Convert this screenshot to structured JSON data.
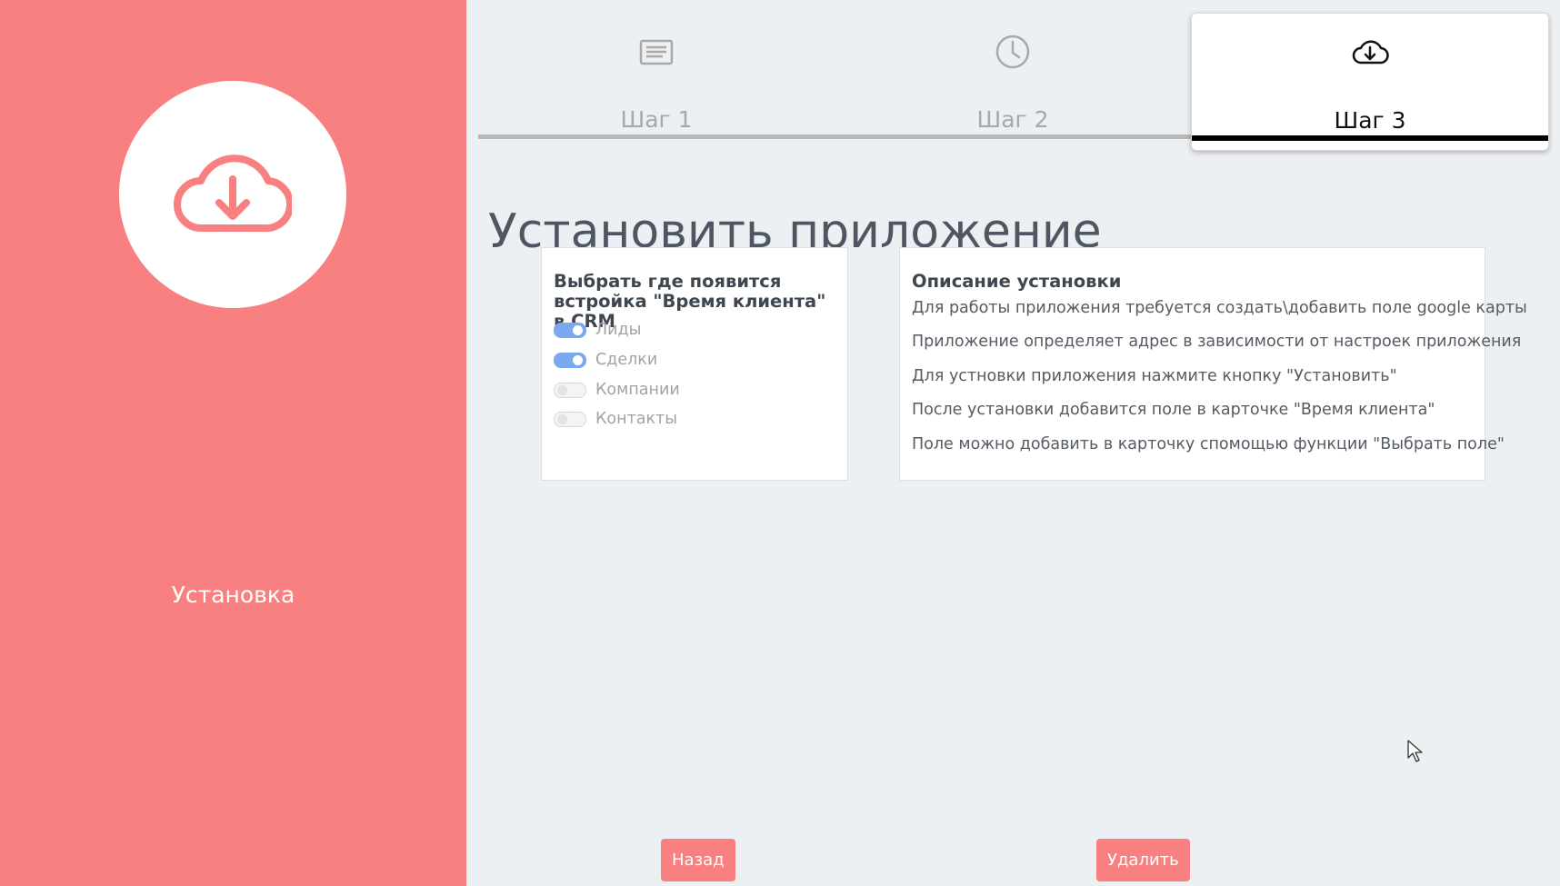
{
  "sidebar": {
    "icon": "cloud-download-icon",
    "caption": "Установка"
  },
  "tabs": [
    {
      "label": "Шаг 1",
      "icon": "document-lines-icon",
      "active": false
    },
    {
      "label": "Шаг 2",
      "icon": "clock-icon",
      "active": false
    },
    {
      "label": "Шаг 3",
      "icon": "cloud-download-icon",
      "active": true
    }
  ],
  "page_title": "Установить приложение",
  "placement_card": {
    "heading": "Выбрать где появится встройка \"Время клиента\" в CRM",
    "options": [
      {
        "label": "Лиды",
        "enabled": true
      },
      {
        "label": "Сделки",
        "enabled": true
      },
      {
        "label": "Компании",
        "enabled": false
      },
      {
        "label": "Контакты",
        "enabled": false
      }
    ]
  },
  "description_card": {
    "heading": "Описание установки",
    "lines": [
      "Для работы приложения требуется создать\\добавить поле google карты",
      "Приложение определяет адрес в зависимости от настроек приложения",
      "Для устновки приложения нажмите кнопку \"Установить\"",
      "После установки добавится поле в карточке \"Время клиента\"",
      "Поле можно добавить в карточку спомощью функции \"Выбрать поле\""
    ]
  },
  "buttons": {
    "back": "Назад",
    "delete": "Удалить"
  },
  "colors": {
    "sidebar": "#f98080",
    "toggle_on": "#7aa8ef",
    "background": "#edf0f3"
  }
}
